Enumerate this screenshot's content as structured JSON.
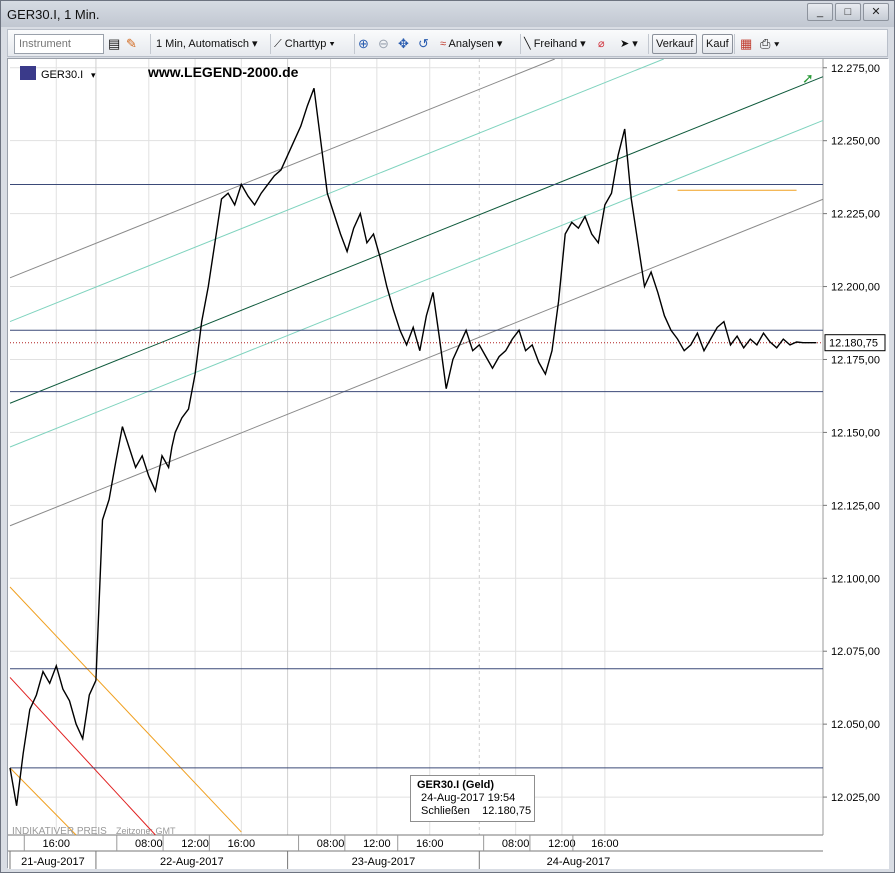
{
  "window": {
    "title": "GER30.I, 1 Min.",
    "minimize_label": "_",
    "maximize_label": "□",
    "close_label": "✕"
  },
  "toolbar": {
    "instrument_placeholder": "Instrument",
    "interval": "1 Min,",
    "scale": "Automatisch",
    "charttype": "Charttyp",
    "analysen": "Analysen",
    "freihand": "Freihand",
    "sell": "Verkauf",
    "buy": "Kauf"
  },
  "chart": {
    "symbol": "GER30.I",
    "watermark": "www.LEGEND-2000.de",
    "footer_left": "INDIKATIVER PREIS",
    "footer_zone": "Zeitzone: GMT",
    "current_price_label": "12.180,75",
    "colors": {
      "price": "#000000",
      "grid": "#e1e1e1",
      "hline": "#3b4a78",
      "dotted_price": "#b02020",
      "orange": "#f0a020",
      "red": "#e02020",
      "dark_green": "#0f5a3c",
      "light_green": "#7fd3be",
      "gray": "#8a8a8a"
    }
  },
  "tooltip": {
    "title": "GER30.I (Geld)",
    "datetime": "24-Aug-2017 19:54",
    "close_label": "Schließen",
    "close_value": "12.180,75"
  },
  "chart_data": {
    "type": "line",
    "title": "GER30.I, 1 Min.",
    "ylim": [
      12012,
      12278
    ],
    "y_ticks": [
      12025,
      12050,
      12075,
      12100,
      12125,
      12150,
      12175,
      12200,
      12225,
      12250,
      12275
    ],
    "y_tick_labels": [
      "12.025,00",
      "12.050,00",
      "12.075,00",
      "12.100,00",
      "12.125,00",
      "12.150,00",
      "12.175,00",
      "12.200,00",
      "12.225,00",
      "12.250,00",
      "12.275,00"
    ],
    "x_time_labels": [
      "16:00",
      "08:00",
      "12:00",
      "16:00",
      "08:00",
      "12:00",
      "16:00",
      "08:00",
      "12:00",
      "16:00"
    ],
    "x_date_labels": [
      "21-Aug-2017",
      "22-Aug-2017",
      "23-Aug-2017",
      "24-Aug-2017"
    ],
    "horizontal_levels": [
      12235,
      12185,
      12164,
      12069,
      12035
    ],
    "last_price": 12180.75,
    "resistance_segment": {
      "from_x": 202,
      "to_x": 238,
      "y": 12233
    },
    "series": [
      {
        "x": [
          0,
          2,
          4,
          6,
          8,
          10,
          12,
          14,
          16,
          18,
          20,
          22,
          24,
          26,
          28,
          30,
          32,
          34,
          36,
          38,
          40,
          42,
          44,
          46,
          48,
          49,
          50,
          52,
          54,
          56,
          58,
          60,
          62,
          64,
          66,
          68,
          70,
          72,
          74,
          76,
          78,
          80,
          82,
          84,
          86,
          88,
          90,
          92,
          94,
          96,
          98,
          100,
          102,
          104,
          106,
          108,
          110,
          112,
          114,
          116,
          118,
          120,
          122,
          124,
          126,
          128,
          130,
          132,
          134,
          136,
          138,
          140,
          142,
          144,
          146,
          148,
          150,
          152,
          154,
          156,
          158,
          160,
          162,
          164,
          166,
          168,
          170,
          172,
          174,
          176,
          178,
          180,
          182,
          184,
          186,
          188,
          190,
          192,
          194,
          196,
          198,
          200,
          202,
          204,
          206,
          208,
          210,
          212,
          214,
          216,
          218,
          220,
          222,
          224,
          226,
          228,
          230,
          232,
          234,
          236,
          238,
          240,
          242,
          244
        ],
        "values": [
          12035,
          12022,
          12040,
          12055,
          12060,
          12068,
          12064,
          12070,
          12062,
          12058,
          12050,
          12045,
          12060,
          12065,
          12120,
          12127,
          12140,
          12152,
          12145,
          12138,
          12142,
          12135,
          12130,
          12142,
          12138,
          12145,
          12150,
          12155,
          12158,
          12170,
          12188,
          12200,
          12215,
          12230,
          12232,
          12228,
          12235,
          12231,
          12228,
          12232,
          12235,
          12238,
          12240,
          12245,
          12250,
          12255,
          12262,
          12268,
          12250,
          12232,
          12225,
          12218,
          12212,
          12220,
          12225,
          12215,
          12218,
          12210,
          12200,
          12192,
          12185,
          12180,
          12186,
          12178,
          12190,
          12198,
          12182,
          12165,
          12175,
          12180,
          12185,
          12178,
          12180,
          12176,
          12172,
          12176,
          12178,
          12182,
          12185,
          12178,
          12180,
          12174,
          12170,
          12178,
          12195,
          12218,
          12222,
          12220,
          12224,
          12218,
          12215,
          12228,
          12232,
          12245,
          12254,
          12230,
          12215,
          12200,
          12205,
          12198,
          12190,
          12185,
          12182,
          12178,
          12180,
          12184,
          12178,
          12182,
          12186,
          12188,
          12180,
          12183,
          12179,
          12182,
          12180,
          12184,
          12181,
          12179,
          12182,
          12180,
          12181,
          12180.75,
          12180.75,
          12180.75
        ]
      }
    ]
  }
}
